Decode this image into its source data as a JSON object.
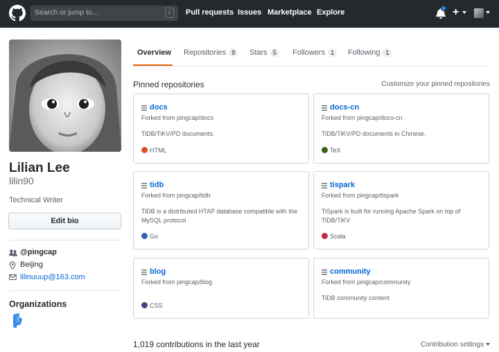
{
  "header": {
    "search_placeholder": "Search or jump to...",
    "search_shortcut": "/",
    "nav": [
      "Pull requests",
      "Issues",
      "Marketplace",
      "Explore"
    ],
    "plus_label": "+"
  },
  "profile": {
    "name": "Lilian Lee",
    "login": "lilin90",
    "bio": "Technical Writer",
    "edit_bio_label": "Edit bio",
    "company": "@pingcap",
    "location": "Beijing",
    "email": "lilinuuup@163.com",
    "organizations_title": "Organizations"
  },
  "tabs": [
    {
      "label": "Overview",
      "count": null,
      "selected": true
    },
    {
      "label": "Repositories",
      "count": "9",
      "selected": false
    },
    {
      "label": "Stars",
      "count": "5",
      "selected": false
    },
    {
      "label": "Followers",
      "count": "1",
      "selected": false
    },
    {
      "label": "Following",
      "count": "1",
      "selected": false
    }
  ],
  "pinned": {
    "title": "Pinned repositories",
    "customize_label": "Customize your pinned repositories",
    "repos": [
      {
        "name": "docs",
        "fork": "Forked from pingcap/docs",
        "description": "TiDB/TiKV/PD documents.",
        "language": "HTML",
        "color": "#e34c26"
      },
      {
        "name": "docs-cn",
        "fork": "Forked from pingcap/docs-cn",
        "description": "TiDB/TiKV/PD documents in Chinese.",
        "language": "TeX",
        "color": "#3d6117"
      },
      {
        "name": "tidb",
        "fork": "Forked from pingcap/tidb",
        "description": "TiDB is a distributed HTAP database compatible with the MySQL protocol",
        "language": "Go",
        "color": "#375eab"
      },
      {
        "name": "tispark",
        "fork": "Forked from pingcap/tispark",
        "description": "TiSpark is built for running Apache Spark on top of TiDB/TiKV",
        "language": "Scala",
        "color": "#c22d40"
      },
      {
        "name": "blog",
        "fork": "Forked from pingcap/blog",
        "description": "",
        "language": "CSS",
        "color": "#563d7c"
      },
      {
        "name": "community",
        "fork": "Forked from pingcap/community",
        "description": "TiDB community content",
        "language": "",
        "color": ""
      }
    ]
  },
  "contributions": {
    "summary": "1,019 contributions in the last year",
    "settings_label": "Contribution settings"
  }
}
